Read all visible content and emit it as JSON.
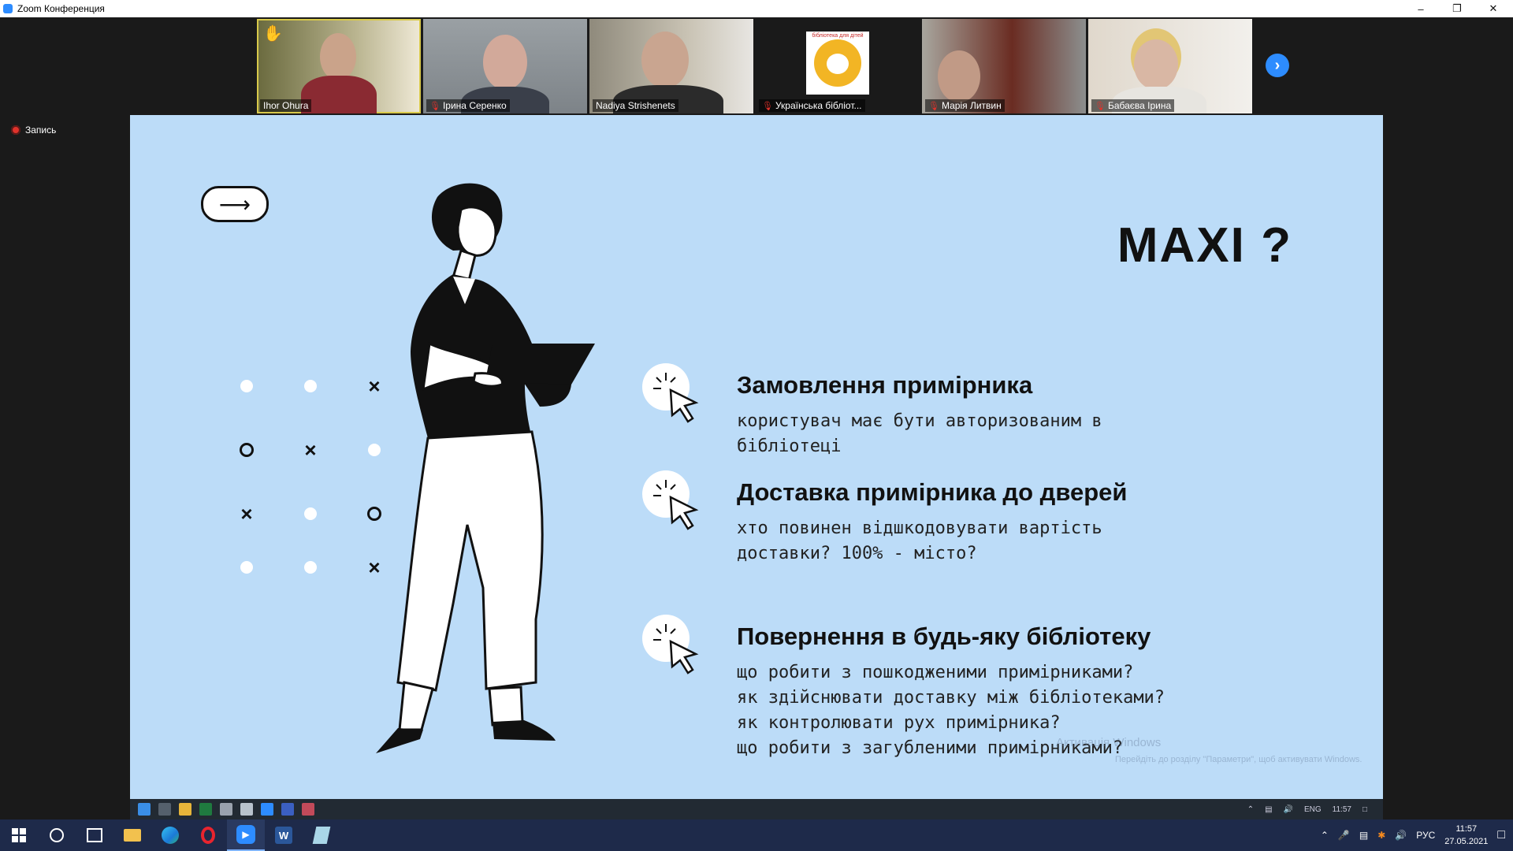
{
  "window": {
    "title": "Zoom Конференция"
  },
  "participants": [
    {
      "name": "Ihor Ohura",
      "muted": false,
      "raised_hand": true,
      "active": true
    },
    {
      "name": "Ірина Серенко",
      "muted": true
    },
    {
      "name": "Nadiya Strishenets",
      "muted": false
    },
    {
      "name": "Українська бібліот...",
      "muted": true,
      "logo_text": "бібліотека для дітей"
    },
    {
      "name": "Марія Литвин",
      "muted": true
    },
    {
      "name": "Бабаєва Ірина",
      "muted": true
    }
  ],
  "recording": {
    "label": "Запись"
  },
  "slide": {
    "heading": "MAXI ?",
    "items": [
      {
        "title": "Замовлення примірника",
        "body": "користувач має бути авторизованим в\nбібліотеці"
      },
      {
        "title": "Доставка примірника до дверей",
        "body": "хто повинен відшкодовувати вартість\nдоставки? 100% - місто?"
      },
      {
        "title": "Повернення в будь-яку бібліотеку",
        "body": "що робити з пошкодженими примірниками?\nяк здійснювати доставку між бібліотеками?\nяк контролювати рух примірника?\nщо робити з загубленими примірниками?"
      }
    ],
    "watermark": {
      "line1": "Активація Windows",
      "line2": "Перейдіть до розділу \"Параметри\", щоб активувати Windows."
    }
  },
  "inner_taskbar": {
    "lang": "ENG",
    "time": "11:57"
  },
  "taskbar": {
    "lang": "РУС",
    "time": "11:57",
    "date": "27.05.2021"
  }
}
